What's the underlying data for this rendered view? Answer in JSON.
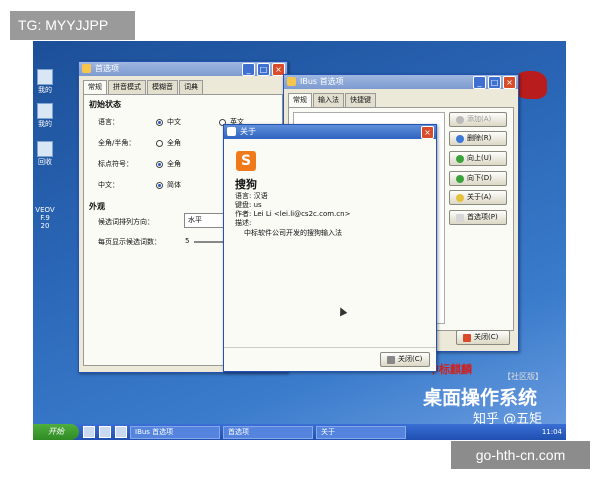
{
  "tag": "TG: MYYJJPP",
  "watermark_bottom": "go-hth-cn.com",
  "desktop_icons": [
    "我的",
    "我的",
    "回收",
    "VEOV\nF.9\n20"
  ],
  "pref_window": {
    "title": "首选项",
    "tabs": [
      "常规",
      "拼音模式",
      "模糊音",
      "词典"
    ],
    "section1": "初始状态",
    "rows": [
      {
        "label": "语言：",
        "a": "中文",
        "b": "英文"
      },
      {
        "label": "全角/半角：",
        "a": "全角",
        "b": ""
      },
      {
        "label": "标点符号：",
        "a": "全角",
        "b": ""
      },
      {
        "label": "中文：",
        "a": "简体",
        "b": ""
      }
    ],
    "section2": "外观",
    "orient_label": "候选词排列方向：",
    "orient_value": "水平",
    "page_label": "每页显示候选词数：",
    "page_value": "5"
  },
  "ibus_window": {
    "title": "IBus 首选项",
    "tabs": [
      "常规",
      "输入法",
      "快捷键"
    ],
    "buttons": [
      "添加(A)",
      "删除(R)",
      "向上(U)",
      "向下(D)",
      "关于(A)",
      "首选项(P)"
    ],
    "close": "关闭(C)"
  },
  "about_window": {
    "title": "关于",
    "name": "搜狗",
    "lang": "语言: 汉语",
    "kbd": "键盘: us",
    "author": "作者: Lei Li <lei.li@cs2c.com.cn>",
    "desc_label": "描述:",
    "desc": "中标软件公司开发的搜狗输入法",
    "close": "关闭(C)",
    "logo_char": "S"
  },
  "branding": {
    "logo": "中标麒麟",
    "edition": "【社区版】",
    "product": "桌面操作系统",
    "zhihu": "知乎 @五矩"
  },
  "taskbar": {
    "start": "开始",
    "tasks": [
      "IBus 首选项",
      "首选项",
      "关于"
    ],
    "clock": "11:04"
  }
}
